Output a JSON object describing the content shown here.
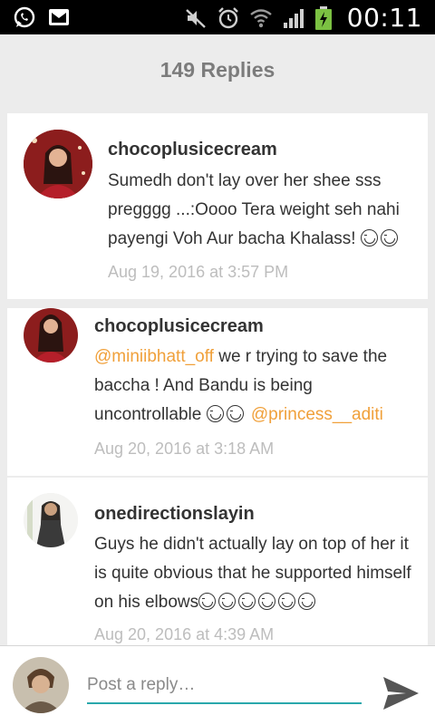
{
  "status_bar": {
    "time": "00:11",
    "left_icons": [
      "whatsapp-icon",
      "mail-icon"
    ],
    "right_icons": [
      "mute-icon",
      "alarm-icon",
      "wifi-icon",
      "signal-icon",
      "battery-icon"
    ]
  },
  "header": {
    "title": "149 Replies"
  },
  "comments": [
    {
      "author": "chocoplusicecream",
      "text": "Sumedh don't lay over her shee sss pregggg ...:Oooo Tera weight seh nahi payengi Voh Aur bacha Khalass!",
      "time": "Aug 19, 2016 at 3:57 PM"
    },
    {
      "author": "chocoplusicecream",
      "mention_1": "@miniibhatt_off",
      "text_1": " we r trying to save the baccha ! And Bandu is being uncontrollable ",
      "mention_2": "@princess__aditi",
      "time": "Aug 20, 2016 at 3:18 AM"
    },
    {
      "author": "onedirectionslayin",
      "text": "Guys he didn't actually lay on top of her it is quite obvious that he supported himself on his elbows",
      "time": "Aug 20, 2016 at 4:39 AM"
    }
  ],
  "reply": {
    "placeholder": "Post a reply…"
  },
  "colors": {
    "mention": "#f0a03a",
    "accent": "#2aa8ac",
    "timestamp": "#bdbdbd"
  }
}
